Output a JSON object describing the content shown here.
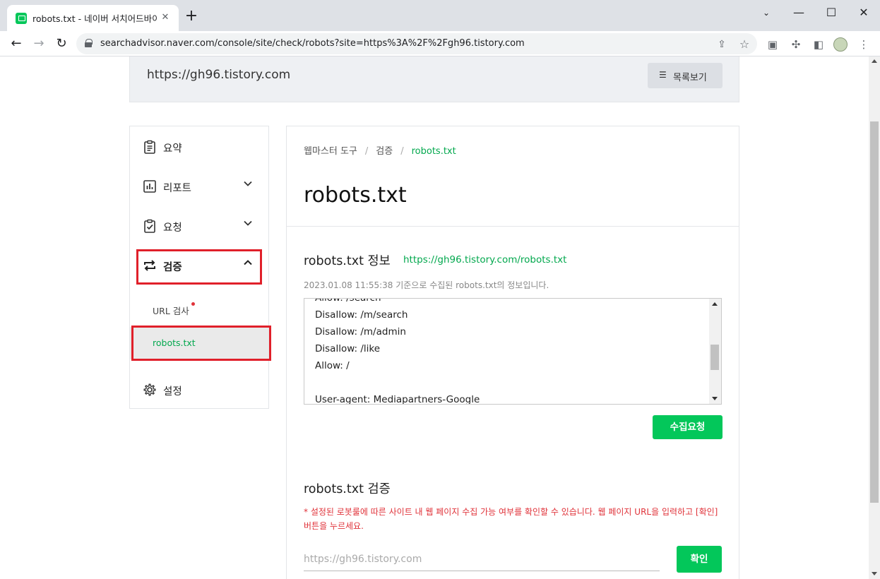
{
  "browser": {
    "tab_title": "robots.txt - 네이버 서치어드바이저",
    "tab_close": "✕",
    "new_tab": "+",
    "url": "searchadvisor.naver.com/console/site/check/robots?site=https%3A%2F%2Fgh96.tistory.com",
    "window_controls": {
      "tab_search": "⌄",
      "minimize": "—",
      "maximize": "☐",
      "close": "✕"
    },
    "nav": {
      "back": "←",
      "forward": "→",
      "reload": "↻"
    },
    "icons": {
      "share": "⇪",
      "star": "☆",
      "media": "▣",
      "extensions": "✣",
      "side_panel": "◧",
      "menu": "⋮",
      "profile": ""
    }
  },
  "header": {
    "site_url": "https://gh96.tistory.com",
    "list_button_label": "목록보기",
    "list_icon": "☰"
  },
  "sidebar": {
    "items": [
      {
        "label": "요약",
        "icon": "clipboard-icon"
      },
      {
        "label": "리포트",
        "icon": "chart-icon",
        "chevron": "⌄"
      },
      {
        "label": "요청",
        "icon": "clipboard-check-icon",
        "chevron": "⌄"
      },
      {
        "label": "검증",
        "icon": "arrows-exchange-icon",
        "chevron": "⌃",
        "expanded": true
      },
      {
        "label": "설정",
        "icon": "gear-icon"
      }
    ],
    "sub_items": [
      {
        "label": "URL 검사",
        "has_dot": true
      },
      {
        "label": "robots.txt",
        "active": true
      }
    ]
  },
  "main": {
    "breadcrumb": [
      "웹마스터 도구",
      "검증",
      "robots.txt"
    ],
    "breadcrumb_sep": "/",
    "page_title": "robots.txt",
    "info": {
      "title": "robots.txt 정보",
      "link": "https://gh96.tistory.com/robots.txt",
      "collected": "2023.01.08 11:55:38 기준으로 수집된 robots.txt의 정보입니다.",
      "lines": [
        "Allow: /search",
        "Disallow: /m/search",
        "Disallow: /m/admin",
        "Disallow: /like",
        "Allow: /",
        "",
        "User-agent: Mediapartners-Google"
      ],
      "collect_button": "수집요청"
    },
    "verify": {
      "title": "robots.txt 검증",
      "note": "* 설정된 로봇룰에 따른 사이트 내 웹 페이지 수집 가능 여부를 확인할 수 있습니다. 웹 페이지 URL을 입력하고 [확인] 버튼을 누르세요.",
      "input_placeholder": "https://gh96.tistory.com",
      "confirm_button": "확인"
    }
  },
  "colors": {
    "accent_green": "#03c75a",
    "link_green": "#03a84e",
    "highlight_red": "#e0202a",
    "note_red": "#e0333a"
  }
}
